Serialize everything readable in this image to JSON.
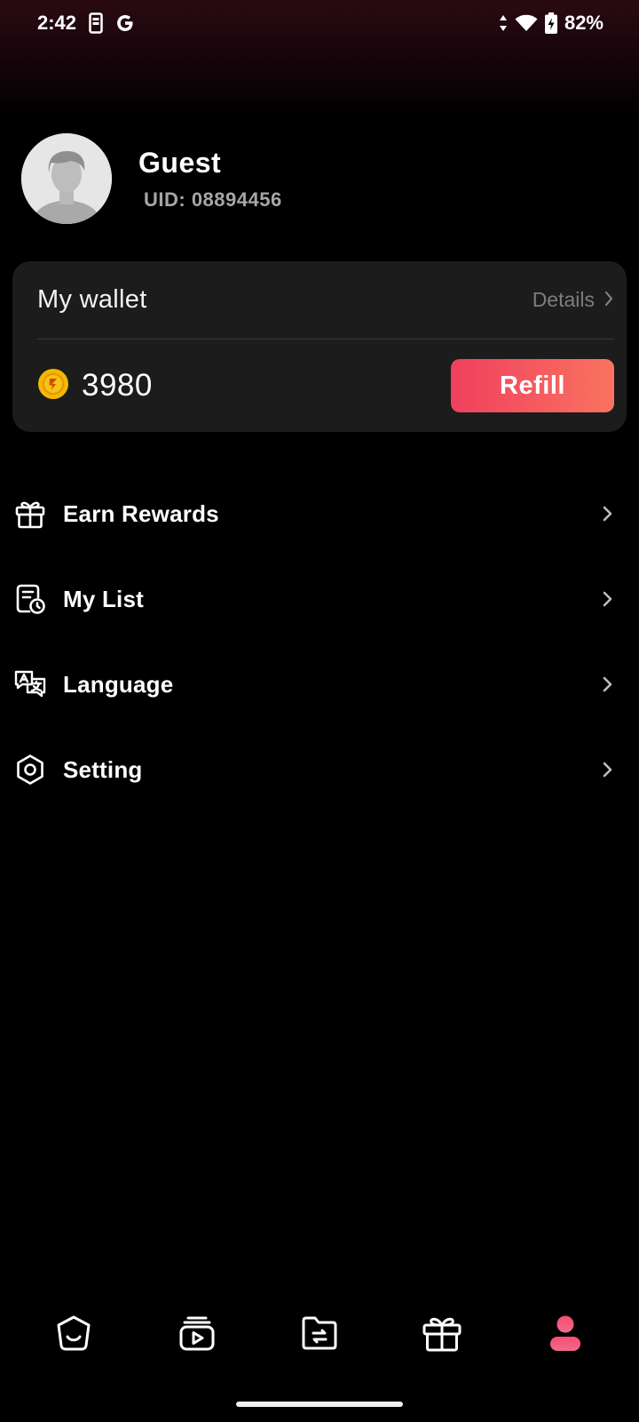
{
  "status_bar": {
    "time": "2:42",
    "carrier_icon": "google-g",
    "battery": "82%"
  },
  "profile": {
    "name": "Guest",
    "uid": "UID: 08894456"
  },
  "wallet": {
    "title": "My wallet",
    "details_label": "Details",
    "balance": "3980",
    "refill_label": "Refill"
  },
  "menu": {
    "items": [
      {
        "label": "Earn Rewards",
        "icon": "gift-icon"
      },
      {
        "label": "My List",
        "icon": "list-clock-icon"
      },
      {
        "label": "Language",
        "icon": "translate-icon"
      },
      {
        "label": "Setting",
        "icon": "settings-hexagon-icon"
      }
    ]
  },
  "bottom_nav": {
    "items": [
      "home-icon",
      "videos-icon",
      "folder-swap-icon",
      "gift-icon",
      "profile-icon"
    ],
    "active": "profile-icon",
    "accent_color": "#f5507a"
  },
  "colors": {
    "refill_gradient_start": "#f0405e",
    "refill_gradient_end": "#fa7360",
    "wallet_bg": "#1c1c1c",
    "coin": "#f5b800"
  }
}
